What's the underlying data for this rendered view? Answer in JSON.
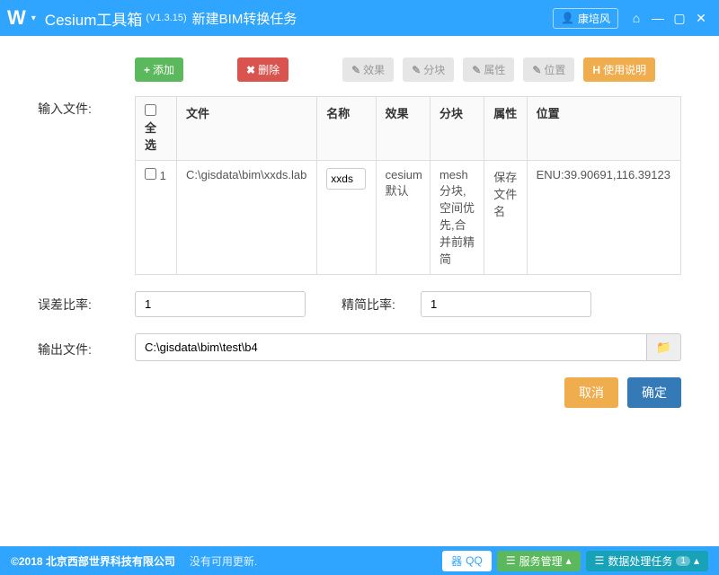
{
  "titlebar": {
    "app_name": "Cesium工具箱",
    "version": "(V1.3.15)",
    "subtitle": "新建BIM转换任务",
    "user": "康培风"
  },
  "toolbar": {
    "add": "添加",
    "delete": "删除",
    "effect": "效果",
    "block": "分块",
    "attr": "属性",
    "position": "位置",
    "help": "使用说明"
  },
  "labels": {
    "input_file": "输入文件:",
    "error_ratio": "误差比率:",
    "simplify_ratio": "精简比率:",
    "output_file": "输出文件:"
  },
  "table": {
    "headers": {
      "select_all": "全选",
      "file": "文件",
      "name": "名称",
      "effect": "效果",
      "block": "分块",
      "attr": "属性",
      "position": "位置"
    },
    "rows": [
      {
        "idx": "1",
        "file": "C:\\gisdata\\bim\\xxds.lab",
        "name": "xxds",
        "effect": "cesium默认",
        "block": "mesh分块,空间优先,合并前精简",
        "attr": "保存文件名",
        "position": "ENU:39.90691,116.39123"
      }
    ]
  },
  "values": {
    "error_ratio": "1",
    "simplify_ratio": "1",
    "output_path": "C:\\gisdata\\bim\\test\\b4"
  },
  "footer": {
    "cancel": "取消",
    "ok": "确定"
  },
  "status": {
    "copyright": "©2018 北京西部世界科技有限公司",
    "update": "没有可用更新.",
    "qq": "QQ",
    "service": "服务管理",
    "tasks": "数据处理任务",
    "task_count": "1"
  }
}
